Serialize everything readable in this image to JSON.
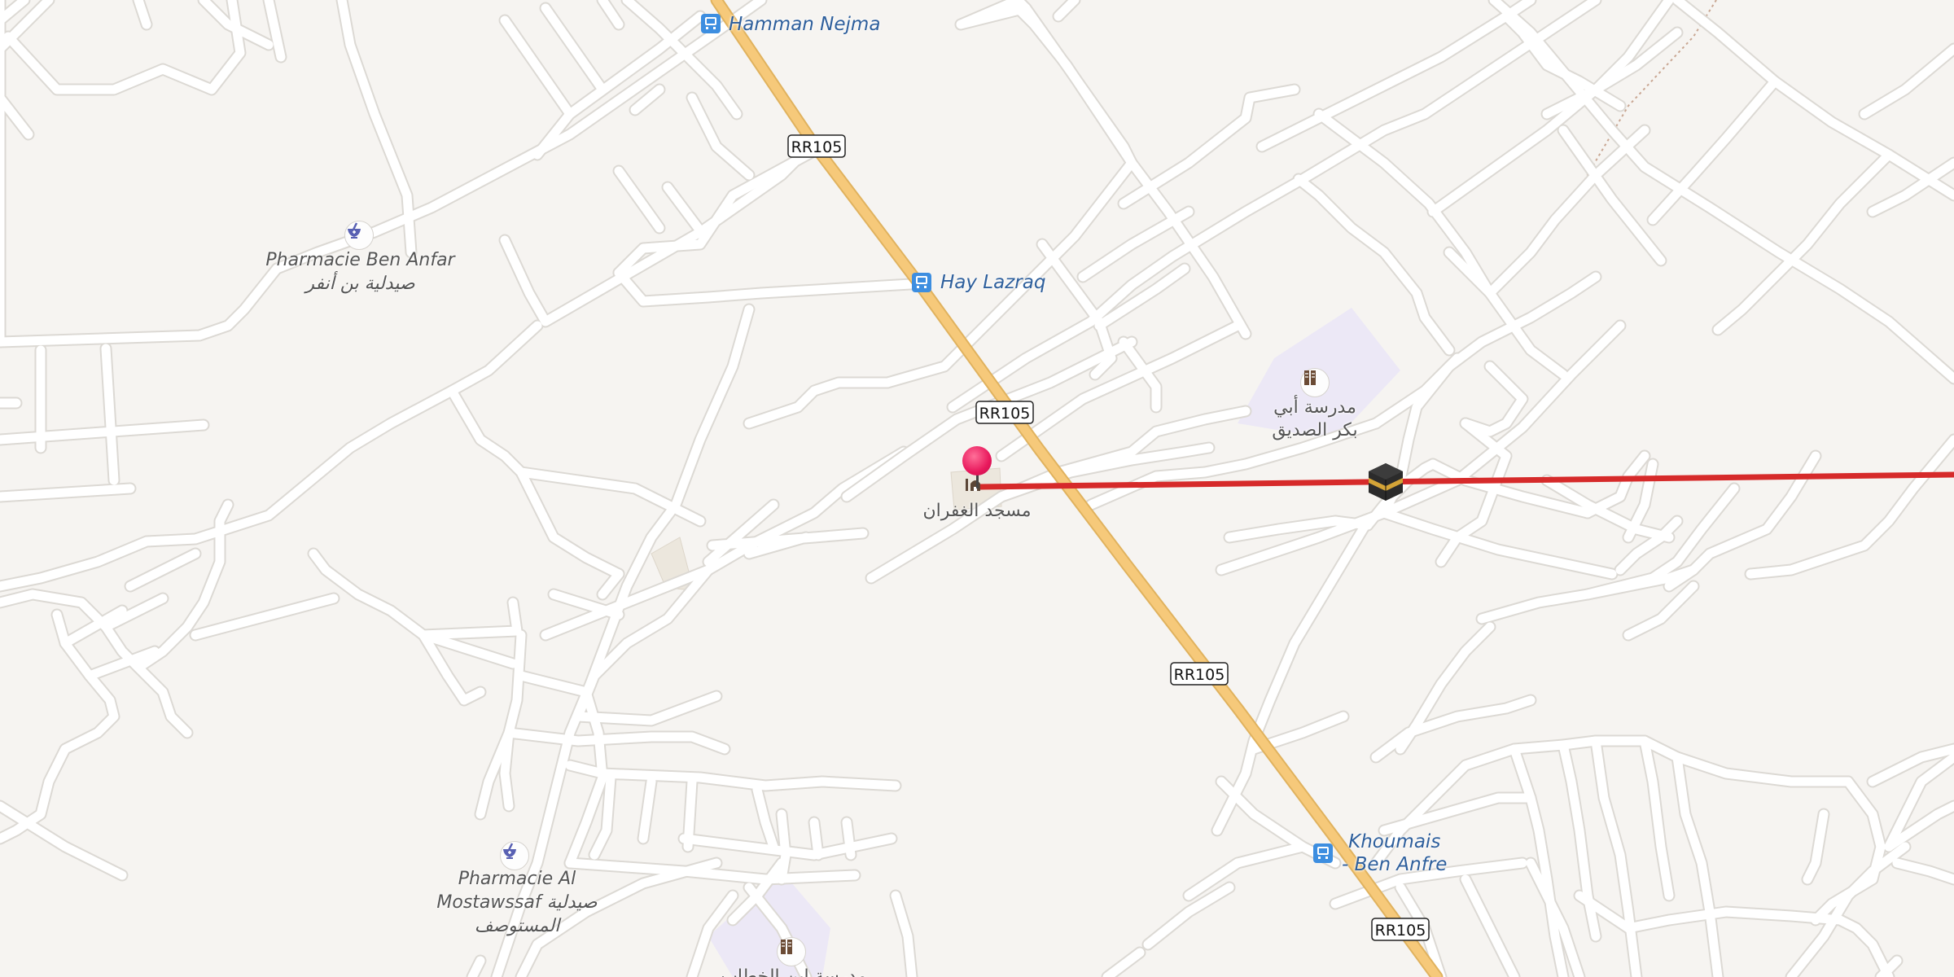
{
  "map": {
    "route_color": "#d62a2a",
    "road_main_color": "#f6c97a",
    "marker_color": "#e8185c",
    "shields": [
      "RR105",
      "RR105",
      "RR105",
      "RR105"
    ],
    "bus_stops": [
      {
        "name": "Hamman Nejma",
        "icon": "bus-icon"
      },
      {
        "name": "Hay Lazraq",
        "icon": "bus-icon"
      },
      {
        "name_line1": "Khoumais",
        "name_line2": "- Ben Anfre",
        "icon": "bus-icon"
      }
    ],
    "pharmacies": [
      {
        "name_line1": "Pharmacie Ben Anfar",
        "name_line2": "صيدلية بن أنفر",
        "icon": "pharmacy-icon"
      },
      {
        "name_line1": "Pharmacie Al",
        "name_line2": "Mostawssaf صيدلية",
        "name_line3": "المستوصف",
        "icon": "pharmacy-icon"
      }
    ],
    "schools": [
      {
        "name_line1": "مدرسة أبي",
        "name_line2": "بكر الصديق",
        "icon": "school-icon"
      },
      {
        "name_line1": "مدرسة ابن الخطاب",
        "icon": "school-icon"
      }
    ],
    "mosque": {
      "name": "مسجد الغفران",
      "icon": "mosque-icon"
    },
    "qibla_marker": {
      "icon": "kaaba-icon"
    }
  }
}
